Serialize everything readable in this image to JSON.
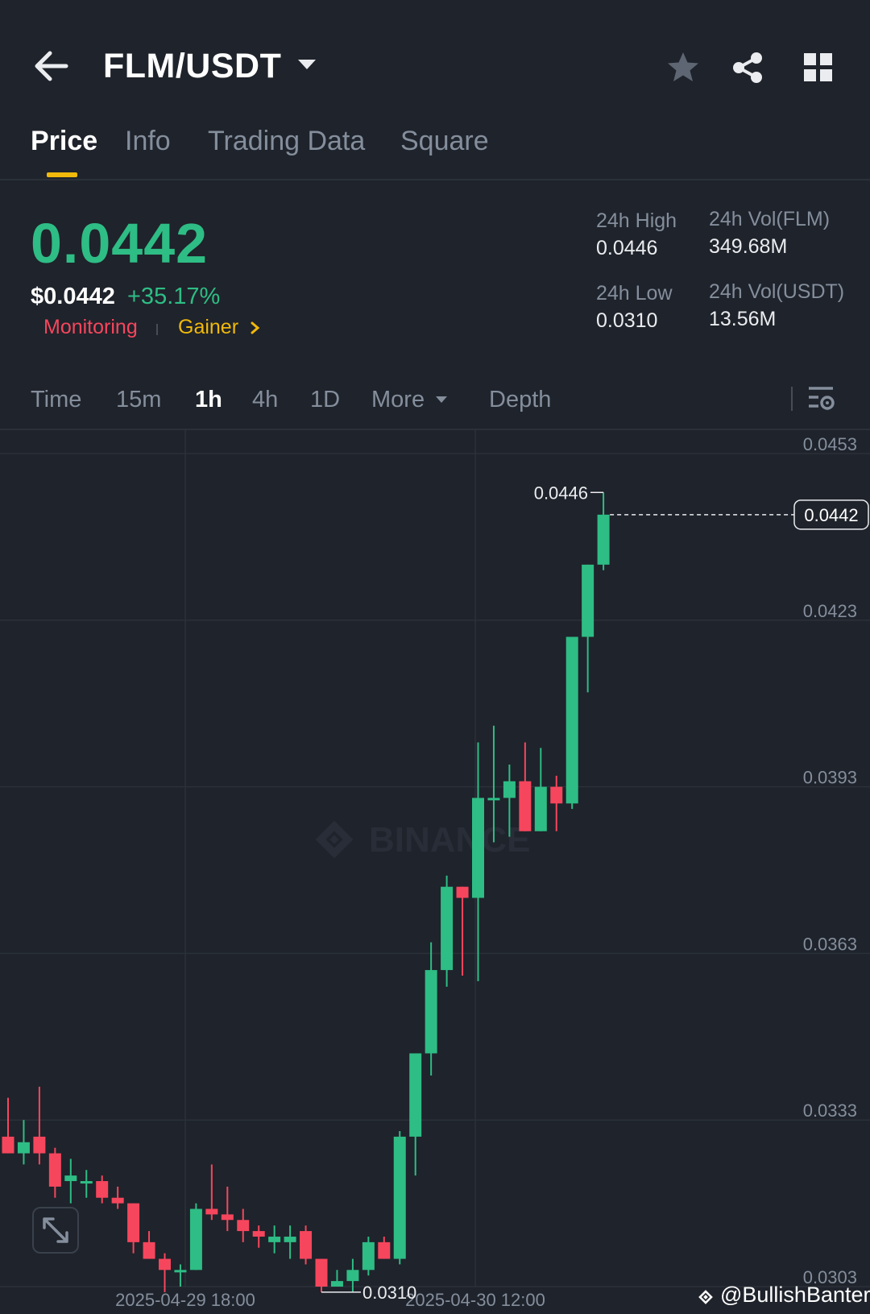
{
  "header": {
    "pair": "FLM/USDT",
    "icons": [
      "back-arrow-icon",
      "caret-down-icon",
      "star-icon",
      "share-icon",
      "grid-icon"
    ]
  },
  "tabs": [
    {
      "label": "Price",
      "active": true
    },
    {
      "label": "Info",
      "active": false
    },
    {
      "label": "Trading Data",
      "active": false
    },
    {
      "label": "Square",
      "active": false
    }
  ],
  "price": {
    "last": "0.0442",
    "usd": "$0.0442",
    "change": "+35.17%",
    "tags": {
      "monitoring": "Monitoring",
      "gainer": "Gainer"
    }
  },
  "stats": {
    "high_label": "24h High",
    "high_value": "0.0446",
    "low_label": "24h Low",
    "low_value": "0.0310",
    "vol_base_label": "24h Vol(FLM)",
    "vol_base_value": "349.68M",
    "vol_quote_label": "24h Vol(USDT)",
    "vol_quote_value": "13.56M"
  },
  "intervals": {
    "items": [
      {
        "label": "Time",
        "active": false
      },
      {
        "label": "15m",
        "active": false
      },
      {
        "label": "1h",
        "active": true
      },
      {
        "label": "4h",
        "active": false
      },
      {
        "label": "1D",
        "active": false
      },
      {
        "label": "More",
        "active": false
      },
      {
        "label": "Depth",
        "active": false
      }
    ]
  },
  "colors": {
    "up": "#2ebd85",
    "down": "#f6465d",
    "accent": "#f0b90b",
    "background": "#1f232b"
  },
  "chart_data": {
    "type": "candlestick",
    "interval": "1h",
    "y_ticks": [
      "0.0453",
      "0.0423",
      "0.0393",
      "0.0363",
      "0.0333",
      "0.0303"
    ],
    "ylim": [
      0.0303,
      0.0453
    ],
    "x_ticks": [
      "2025-04-29 18:00",
      "2025-04-30 12:00"
    ],
    "grid": true,
    "watermark": "BINANCE",
    "high_marker": "0.0446",
    "low_marker": "0.0310",
    "last_price_label": "0.0442",
    "candles": [
      {
        "o": 0.033,
        "h": 0.0337,
        "l": 0.0327,
        "c": 0.0327
      },
      {
        "o": 0.0327,
        "h": 0.0333,
        "l": 0.0325,
        "c": 0.0329
      },
      {
        "o": 0.033,
        "h": 0.0339,
        "l": 0.0325,
        "c": 0.0327
      },
      {
        "o": 0.0327,
        "h": 0.0328,
        "l": 0.0319,
        "c": 0.0321
      },
      {
        "o": 0.0322,
        "h": 0.0326,
        "l": 0.0318,
        "c": 0.0323
      },
      {
        "o": 0.0322,
        "h": 0.0324,
        "l": 0.0319,
        "c": 0.0322
      },
      {
        "o": 0.0322,
        "h": 0.0323,
        "l": 0.0318,
        "c": 0.0319
      },
      {
        "o": 0.0319,
        "h": 0.0321,
        "l": 0.0317,
        "c": 0.0318
      },
      {
        "o": 0.0318,
        "h": 0.0318,
        "l": 0.0309,
        "c": 0.0311
      },
      {
        "o": 0.0311,
        "h": 0.0313,
        "l": 0.0308,
        "c": 0.0308
      },
      {
        "o": 0.0308,
        "h": 0.0309,
        "l": 0.0302,
        "c": 0.0306
      },
      {
        "o": 0.0306,
        "h": 0.0307,
        "l": 0.0303,
        "c": 0.0306
      },
      {
        "o": 0.0306,
        "h": 0.0318,
        "l": 0.0306,
        "c": 0.0317
      },
      {
        "o": 0.0317,
        "h": 0.0325,
        "l": 0.0315,
        "c": 0.0316
      },
      {
        "o": 0.0316,
        "h": 0.0321,
        "l": 0.0313,
        "c": 0.0315
      },
      {
        "o": 0.0315,
        "h": 0.0317,
        "l": 0.0311,
        "c": 0.0313
      },
      {
        "o": 0.0313,
        "h": 0.0314,
        "l": 0.031,
        "c": 0.0312
      },
      {
        "o": 0.0311,
        "h": 0.0314,
        "l": 0.0309,
        "c": 0.0312
      },
      {
        "o": 0.0311,
        "h": 0.0314,
        "l": 0.0308,
        "c": 0.0312
      },
      {
        "o": 0.0313,
        "h": 0.0314,
        "l": 0.0307,
        "c": 0.0308
      },
      {
        "o": 0.0308,
        "h": 0.0308,
        "l": 0.0302,
        "c": 0.0303
      },
      {
        "o": 0.0303,
        "h": 0.0306,
        "l": 0.0303,
        "c": 0.0304
      },
      {
        "o": 0.0304,
        "h": 0.0308,
        "l": 0.0302,
        "c": 0.0306
      },
      {
        "o": 0.0306,
        "h": 0.0312,
        "l": 0.0305,
        "c": 0.0311
      },
      {
        "o": 0.0311,
        "h": 0.0312,
        "l": 0.0308,
        "c": 0.0308
      },
      {
        "o": 0.0308,
        "h": 0.0331,
        "l": 0.0307,
        "c": 0.033
      },
      {
        "o": 0.033,
        "h": 0.0343,
        "l": 0.0323,
        "c": 0.0345
      },
      {
        "o": 0.0345,
        "h": 0.0365,
        "l": 0.0341,
        "c": 0.036
      },
      {
        "o": 0.036,
        "h": 0.0377,
        "l": 0.0357,
        "c": 0.0375
      },
      {
        "o": 0.0375,
        "h": 0.0374,
        "l": 0.0359,
        "c": 0.0373
      },
      {
        "o": 0.0373,
        "h": 0.0401,
        "l": 0.0358,
        "c": 0.0391
      },
      {
        "o": 0.0391,
        "h": 0.0404,
        "l": 0.0383,
        "c": 0.0391
      },
      {
        "o": 0.0391,
        "h": 0.0397,
        "l": 0.0384,
        "c": 0.0394
      },
      {
        "o": 0.0394,
        "h": 0.0401,
        "l": 0.0385,
        "c": 0.0385
      },
      {
        "o": 0.0385,
        "h": 0.04,
        "l": 0.0386,
        "c": 0.0393
      },
      {
        "o": 0.0393,
        "h": 0.0395,
        "l": 0.0385,
        "c": 0.039
      },
      {
        "o": 0.039,
        "h": 0.0418,
        "l": 0.0389,
        "c": 0.042
      },
      {
        "o": 0.042,
        "h": 0.0432,
        "l": 0.041,
        "c": 0.0433
      },
      {
        "o": 0.0433,
        "h": 0.0446,
        "l": 0.0432,
        "c": 0.0442
      }
    ]
  },
  "footer": {
    "credit": "@BullishBanter"
  }
}
